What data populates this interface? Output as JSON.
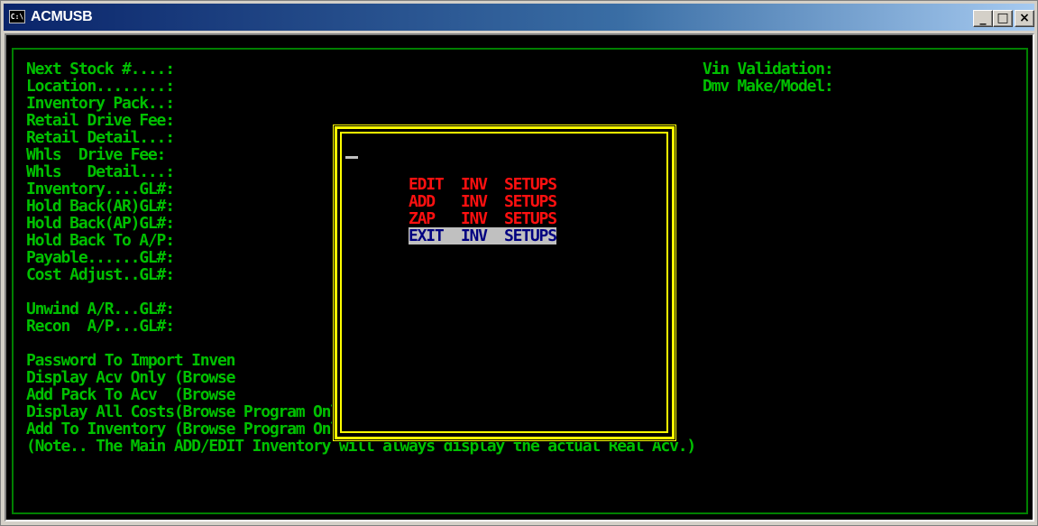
{
  "window": {
    "title": "ACMUSB",
    "icon_label": "C:\\",
    "buttons": {
      "minimize": "_",
      "maximize": "□",
      "close": "×"
    }
  },
  "colors": {
    "field_text": "#00c000",
    "menu_text": "#ff1010",
    "menu_selected_bg": "#c0c0c0",
    "menu_selected_text": "#000080",
    "popup_border": "#ffff00",
    "console_bg": "#000000"
  },
  "left_fields": [
    "Next Stock #....:",
    "Location........:",
    "Inventory Pack..:",
    "Retail Drive Fee:",
    "Retail Detail...:",
    "Whls  Drive Fee:",
    "Whls   Detail...:",
    "Inventory....GL#:",
    "Hold Back(AR)GL#:",
    "Hold Back(AP)GL#:",
    "Hold Back To A/P:",
    "Payable......GL#:",
    "Cost Adjust..GL#:",
    "",
    "Unwind A/R...GL#:",
    "Recon  A/P...GL#:",
    "",
    "Password To Import Inven",
    "Display Acv Only (Browse",
    "Add Pack To Acv  (Browse",
    "Display All Costs(Browse Program Only):",
    "Add To Inventory (Browse Program Only):",
    "(Note.. The Main ADD/EDIT Inventory will always display the actual Real Acv.)"
  ],
  "right_fields": [
    "Vin Validation:",
    "Dmv Make/Model:"
  ],
  "menu": {
    "items": [
      {
        "label": "EDIT  INV  SETUPS",
        "selected": false
      },
      {
        "label": "ADD   INV  SETUPS",
        "selected": false
      },
      {
        "label": "ZAP   INV  SETUPS",
        "selected": false
      },
      {
        "label": "EXIT  INV  SETUPS",
        "selected": true
      }
    ]
  }
}
